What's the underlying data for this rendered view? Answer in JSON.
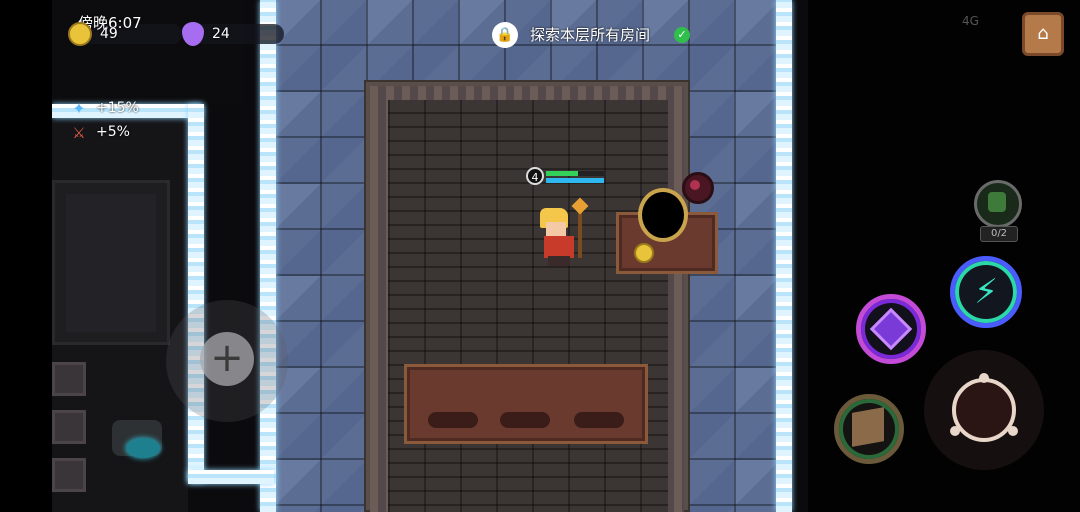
{
  "status_bar": {
    "time": "傍晚6:07",
    "network": "4G"
  },
  "resources": {
    "gold": "49",
    "gems": "24"
  },
  "buffs": [
    {
      "icon": "sparkle-icon",
      "text": "+15%"
    },
    {
      "icon": "sword-icon",
      "text": "+5%"
    }
  ],
  "quest": {
    "text": "探索本层所有房间",
    "completed": true
  },
  "player": {
    "level": "4",
    "hp_fraction": 0.55,
    "mp_fraction": 1.0
  },
  "pet": {
    "count": "0/2"
  },
  "skills": [
    "lightning-skill",
    "eye-skill",
    "box-skill"
  ],
  "colors": {
    "stone_floor": "#5c6d93",
    "ice": "#dff4ff",
    "room_floor": "#3b3533",
    "table": "#6b3a2e",
    "hp": "#33d15a",
    "mp": "#2fb8ef",
    "skill_lightning": "#2ad8a8",
    "skill_eye": "#c44ad8"
  }
}
